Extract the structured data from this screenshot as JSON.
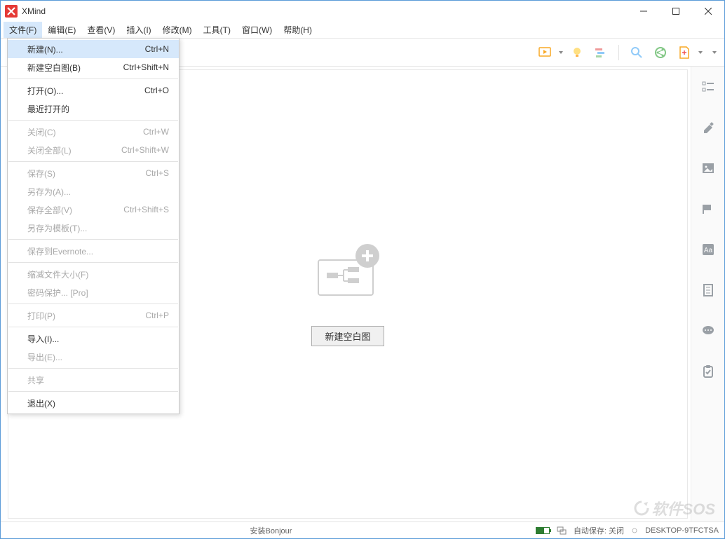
{
  "app": {
    "title": "XMind"
  },
  "menubar": {
    "items": [
      {
        "label": "文件(F)"
      },
      {
        "label": "编辑(E)"
      },
      {
        "label": "查看(V)"
      },
      {
        "label": "插入(I)"
      },
      {
        "label": "修改(M)"
      },
      {
        "label": "工具(T)"
      },
      {
        "label": "窗口(W)"
      },
      {
        "label": "帮助(H)"
      }
    ]
  },
  "fileMenu": {
    "groups": [
      [
        {
          "label": "新建(N)...",
          "accel": "Ctrl+N",
          "highlight": true
        },
        {
          "label": "新建空白图(B)",
          "accel": "Ctrl+Shift+N"
        }
      ],
      [
        {
          "label": "打开(O)...",
          "accel": "Ctrl+O"
        },
        {
          "label": "最近打开的",
          "accel": ""
        }
      ],
      [
        {
          "label": "关闭(C)",
          "accel": "Ctrl+W",
          "disabled": true
        },
        {
          "label": "关闭全部(L)",
          "accel": "Ctrl+Shift+W",
          "disabled": true
        }
      ],
      [
        {
          "label": "保存(S)",
          "accel": "Ctrl+S",
          "disabled": true
        },
        {
          "label": "另存为(A)...",
          "accel": "",
          "disabled": true
        },
        {
          "label": "保存全部(V)",
          "accel": "Ctrl+Shift+S",
          "disabled": true
        },
        {
          "label": "另存为模板(T)...",
          "accel": "",
          "disabled": true
        }
      ],
      [
        {
          "label": "保存到Evernote...",
          "accel": "",
          "disabled": true
        }
      ],
      [
        {
          "label": "缩减文件大小(F)",
          "accel": "",
          "disabled": true
        },
        {
          "label": "密码保护... [Pro]",
          "accel": "",
          "disabled": true
        }
      ],
      [
        {
          "label": "打印(P)",
          "accel": "Ctrl+P",
          "disabled": true
        }
      ],
      [
        {
          "label": "导入(I)...",
          "accel": ""
        },
        {
          "label": "导出(E)...",
          "accel": "",
          "disabled": true
        }
      ],
      [
        {
          "label": "共享",
          "accel": "",
          "disabled": true
        }
      ],
      [
        {
          "label": "退出(X)",
          "accel": ""
        }
      ]
    ]
  },
  "canvas": {
    "createBlankLabel": "新建空白图"
  },
  "statusbar": {
    "center": "安装Bonjour",
    "autosave": "自动保存: 关闭",
    "host": "DESKTOP-9TFCTSA"
  },
  "watermark": "软件SOS"
}
